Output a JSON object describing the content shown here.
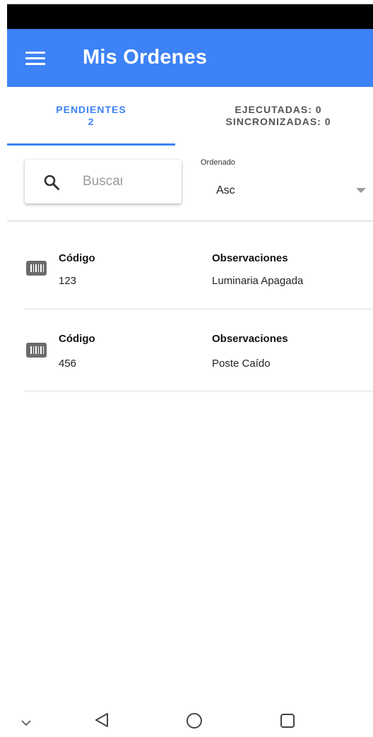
{
  "app": {
    "title": "Mis Ordenes"
  },
  "colors": {
    "primary": "#3d82f6",
    "status_bar": "#000000",
    "icon_gray": "#6b6b6b"
  },
  "icons": {
    "menu": "hamburger-menu-icon",
    "search": "magnifier-search-icon",
    "dropdown": "caret-down-icon",
    "order": "barcode-icon",
    "nav": [
      "chevron-down-icon",
      "triangle-back-icon",
      "circle-home-icon",
      "square-recents-icon"
    ]
  },
  "tabs": [
    {
      "label": "PENDIENTES",
      "count": "2",
      "selected": true
    },
    {
      "label": "EJECUTADAS: 0",
      "sublabel": "SINCRONIZADAS: 0",
      "selected": false
    }
  ],
  "search": {
    "placeholder": "Buscar",
    "value": ""
  },
  "sort": {
    "label": "Ordenado",
    "value": "Asc"
  },
  "orders": [
    {
      "code_label": "Código",
      "code": "123",
      "obs_label": "Observaciones",
      "observation": "Luminaria Apagada"
    },
    {
      "code_label": "Código",
      "code": "456",
      "obs_label": "Observaciones",
      "observation": "Poste Caído"
    }
  ]
}
